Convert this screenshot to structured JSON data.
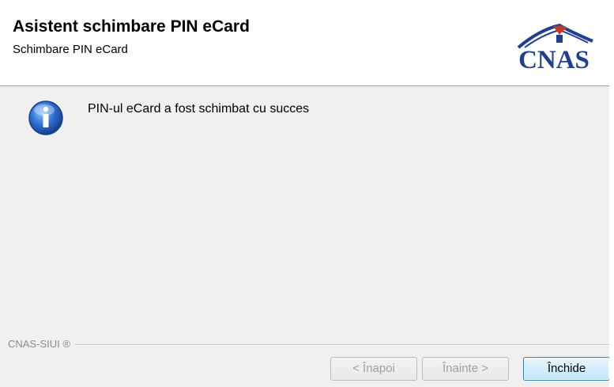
{
  "header": {
    "title": "Asistent schimbare PIN eCard",
    "subtitle": "Schimbare PIN eCard",
    "logo_text": "CNAS"
  },
  "main": {
    "icon": "info-icon",
    "message": "PIN-ul eCard a fost schimbat cu succes"
  },
  "footer": {
    "brand_label": "CNAS-SIUI ®"
  },
  "buttons": {
    "back_label": "< Înapoi",
    "next_label": "Înainte >",
    "close_label": "Închide"
  },
  "colors": {
    "logo": "#1f3f8f",
    "roof": "#1f3f8f",
    "roof_accent": "#c0392b",
    "info_icon": "#2f6fd0"
  }
}
